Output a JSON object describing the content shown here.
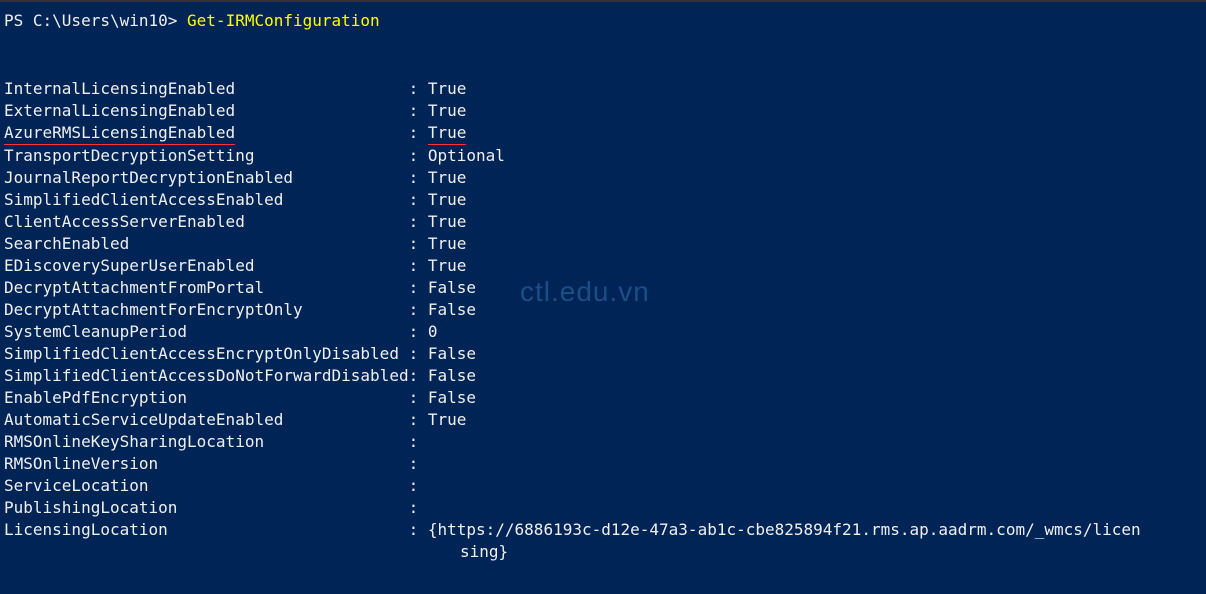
{
  "prompt": {
    "prefix": "PS C:\\Users\\win10>",
    "command": "Get-IRMConfiguration"
  },
  "output": [
    {
      "key": "InternalLicensingEnabled",
      "value": "True",
      "highlight": false
    },
    {
      "key": "ExternalLicensingEnabled",
      "value": "True",
      "highlight": false
    },
    {
      "key": "AzureRMSLicensingEnabled",
      "value": "True",
      "highlight": true
    },
    {
      "key": "TransportDecryptionSetting",
      "value": "Optional",
      "highlight": false
    },
    {
      "key": "JournalReportDecryptionEnabled",
      "value": "True",
      "highlight": false
    },
    {
      "key": "SimplifiedClientAccessEnabled",
      "value": "True",
      "highlight": false
    },
    {
      "key": "ClientAccessServerEnabled",
      "value": "True",
      "highlight": false
    },
    {
      "key": "SearchEnabled",
      "value": "True",
      "highlight": false
    },
    {
      "key": "EDiscoverySuperUserEnabled",
      "value": "True",
      "highlight": false
    },
    {
      "key": "DecryptAttachmentFromPortal",
      "value": "False",
      "highlight": false
    },
    {
      "key": "DecryptAttachmentForEncryptOnly",
      "value": "False",
      "highlight": false
    },
    {
      "key": "SystemCleanupPeriod",
      "value": "0",
      "highlight": false
    },
    {
      "key": "SimplifiedClientAccessEncryptOnlyDisabled",
      "value": "False",
      "highlight": false
    },
    {
      "key": "SimplifiedClientAccessDoNotForwardDisabled",
      "value": "False",
      "highlight": false
    },
    {
      "key": "EnablePdfEncryption",
      "value": "False",
      "highlight": false
    },
    {
      "key": "AutomaticServiceUpdateEnabled",
      "value": "True",
      "highlight": false
    },
    {
      "key": "RMSOnlineKeySharingLocation",
      "value": "",
      "highlight": false
    },
    {
      "key": "RMSOnlineVersion",
      "value": "",
      "highlight": false
    },
    {
      "key": "ServiceLocation",
      "value": "",
      "highlight": false
    },
    {
      "key": "PublishingLocation",
      "value": "",
      "highlight": false
    },
    {
      "key": "LicensingLocation",
      "value": "{https://6886193c-d12e-47a3-ab1c-cbe825894f21.rms.ap.aadrm.com/_wmcs/licen",
      "highlight": false
    }
  ],
  "continuation": "sing}",
  "watermark": "ctl.edu.vn",
  "pad_width": 42
}
